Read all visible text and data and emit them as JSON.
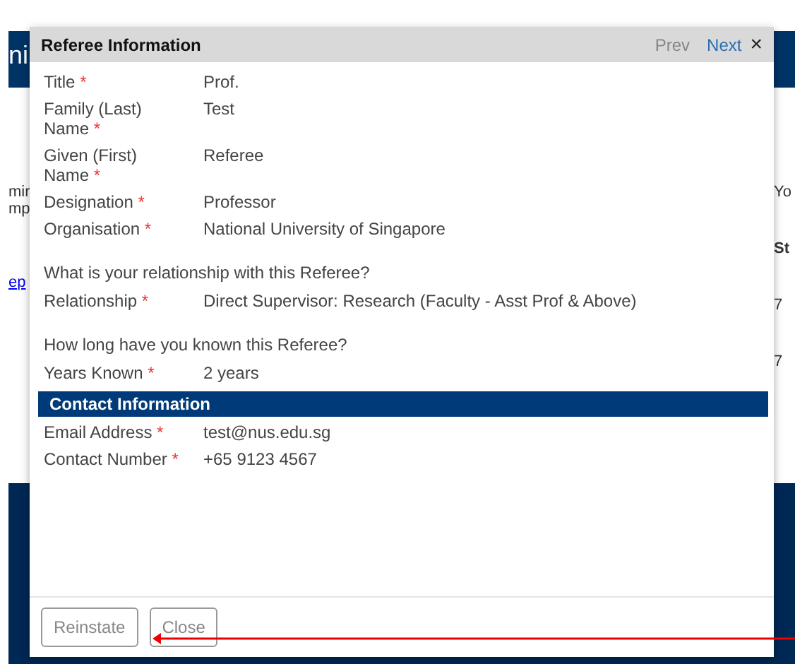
{
  "background": {
    "header_fragment": "ni",
    "left_fragments": [
      {
        "text": "mir",
        "kind": "text"
      },
      {
        "text": "mp",
        "kind": "text"
      },
      {
        "text": "ep",
        "kind": "link"
      }
    ],
    "right_fragments": [
      {
        "text": "Yo",
        "kind": "text"
      },
      {
        "text": "St",
        "kind": "heading"
      },
      {
        "text": "7",
        "kind": "text"
      },
      {
        "text": "7",
        "kind": "text"
      }
    ]
  },
  "dialog": {
    "title": "Referee Information",
    "nav": [
      {
        "label": "Prev",
        "disabled": true
      },
      {
        "label": "Next",
        "disabled": false
      }
    ],
    "close": "×",
    "sections": [
      {
        "kind": "fields",
        "items": [
          {
            "label": "Title",
            "required_mark": "*",
            "value": "Prof."
          },
          {
            "label": "Family (Last) Name",
            "required_mark": "*",
            "value": "Test"
          },
          {
            "label": "Given (First) Name",
            "required_mark": "*",
            "value": "Referee"
          },
          {
            "label": "Designation",
            "required_mark": "*",
            "value": "Professor"
          },
          {
            "label": "Organisation",
            "required_mark": "*",
            "value": "National University of Singapore"
          }
        ]
      },
      {
        "kind": "question",
        "text": "What is your relationship with this Referee?"
      },
      {
        "kind": "fields",
        "items": [
          {
            "label": "Relationship",
            "required_mark": "*",
            "value": "Direct Supervisor: Research (Faculty - Asst Prof & Above)"
          }
        ]
      },
      {
        "kind": "question",
        "text": "How long have you known this Referee?"
      },
      {
        "kind": "fields",
        "items": [
          {
            "label": "Years Known",
            "required_mark": "*",
            "value": "2 years"
          }
        ]
      },
      {
        "kind": "heading",
        "text": "Contact Information"
      },
      {
        "kind": "fields",
        "items": [
          {
            "label": "Email Address",
            "required_mark": "*",
            "value": "test@nus.edu.sg"
          },
          {
            "label": "Contact Number",
            "required_mark": "*",
            "value": "+65 9123 4567"
          }
        ]
      }
    ],
    "buttons": [
      {
        "label": "Reinstate"
      },
      {
        "label": "Close"
      }
    ]
  }
}
